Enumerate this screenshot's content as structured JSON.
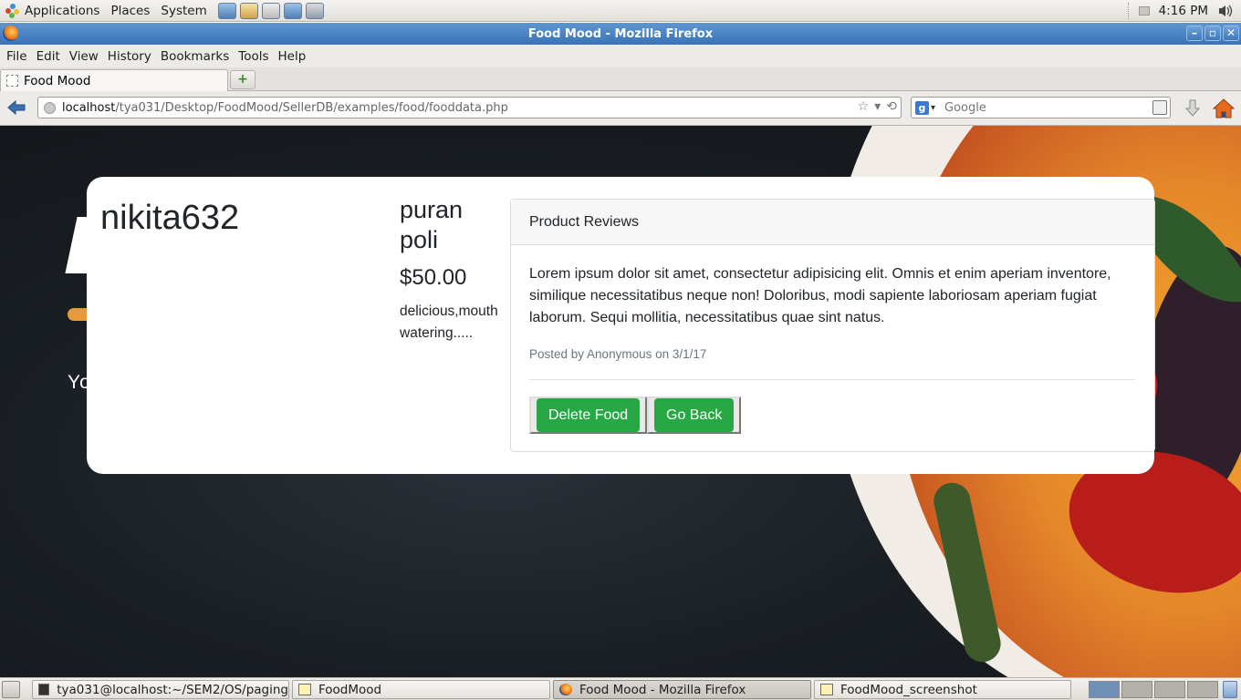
{
  "top_panel": {
    "menus": [
      "Applications",
      "Places",
      "System"
    ],
    "launchers": [
      "network-icon",
      "mail-icon",
      "notes-icon",
      "text-editor-icon",
      "chat-icon"
    ],
    "clock": "4:16 PM"
  },
  "window": {
    "title": "Food Mood - Mozilla Firefox",
    "controls": [
      "minimize",
      "maximize",
      "close"
    ]
  },
  "menubar": {
    "items": [
      {
        "label": "File",
        "access": "F"
      },
      {
        "label": "Edit",
        "access": "E"
      },
      {
        "label": "View",
        "access": "V"
      },
      {
        "label": "History",
        "access": "s"
      },
      {
        "label": "Bookmarks",
        "access": "B"
      },
      {
        "label": "Tools",
        "access": "T"
      },
      {
        "label": "Help",
        "access": "H"
      }
    ]
  },
  "tabs": [
    {
      "label": "Food Mood",
      "active": true
    }
  ],
  "newtab_label": "+",
  "navbar": {
    "url_host": "localhost",
    "url_path": "/tya031/Desktop/FoodMood/SellerDB/examples/food/fooddata.php",
    "search_placeholder": "Google",
    "search_engine_letter": "g"
  },
  "page": {
    "hero_tagline": "Yo",
    "seller_name": "nikita632",
    "food_name": "puran poli",
    "food_price": "$50.00",
    "food_description": "delicious,mouth watering.....",
    "reviews": {
      "header": "Product Reviews",
      "items": [
        {
          "text": "Lorem ipsum dolor sit amet, consectetur adipisicing elit. Omnis et enim aperiam inventore, similique necessitatibus neque non! Doloribus, modi sapiente laboriosam aperiam fugiat laborum. Sequi mollitia, necessitatibus quae sint natus.",
          "meta": "Posted by Anonymous on 3/1/17"
        }
      ]
    },
    "buttons": {
      "delete": "Delete Food",
      "back": "Go Back"
    },
    "colors": {
      "button_green": "#28a745",
      "muted_text": "#6c757d"
    }
  },
  "taskbar": {
    "tasks": [
      {
        "label": "tya031@localhost:~/SEM2/OS/paging",
        "icon": "terminal-icon",
        "active": false
      },
      {
        "label": "FoodMood",
        "icon": "folder-icon",
        "active": false
      },
      {
        "label": "Food Mood - Mozilla Firefox",
        "icon": "firefox-icon",
        "active": true
      },
      {
        "label": "FoodMood_screenshot",
        "icon": "folder-icon",
        "active": false
      }
    ],
    "workspaces": 4,
    "active_workspace": 1
  }
}
